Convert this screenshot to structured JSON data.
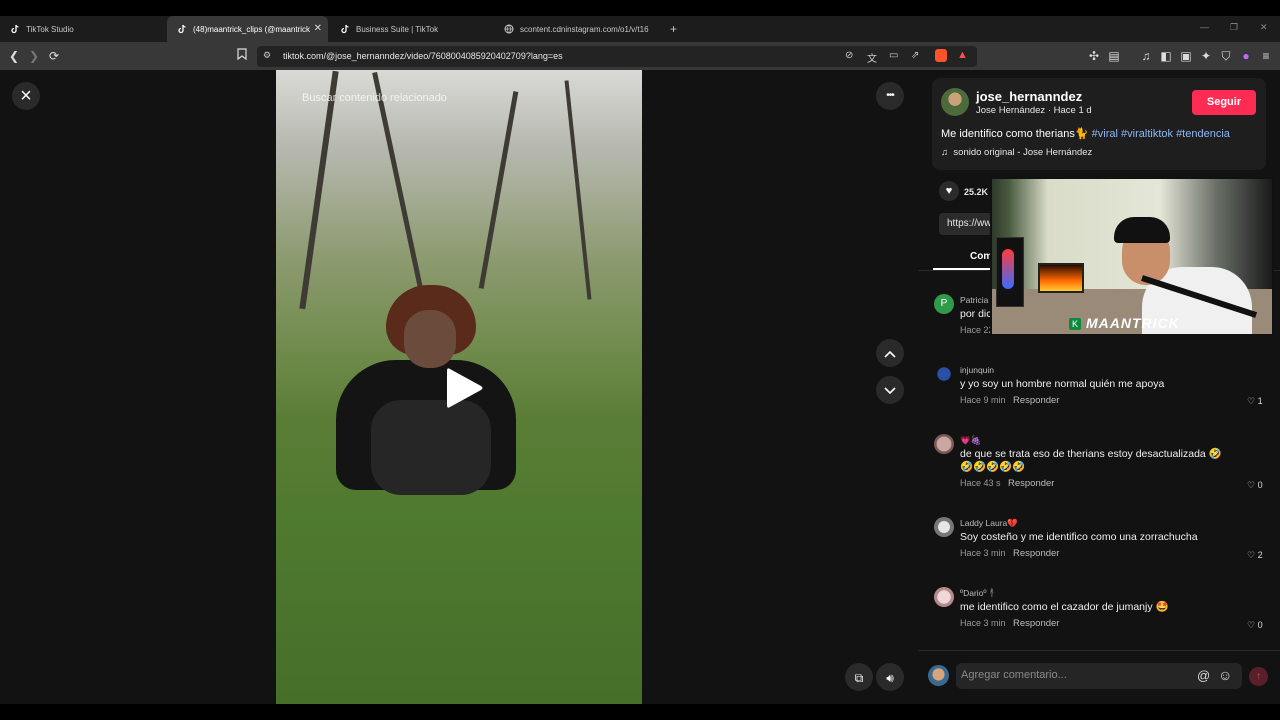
{
  "browser": {
    "tabs": [
      {
        "label": "TikTok Studio",
        "active": false
      },
      {
        "label": "(48)maantrick_clips (@maantrick",
        "active": true
      },
      {
        "label": "Business Suite | TikTok",
        "active": false
      },
      {
        "label": "scontent.cdninstagram.com/o1/v/t16",
        "active": false
      }
    ],
    "new_tab": "+",
    "url": "tiktok.com/@jose_hernanndez/video/7608004085920402709?lang=es"
  },
  "video": {
    "overlay_text": "Buscar contenido relacionado",
    "close_icon": "×",
    "more_icon": "•••"
  },
  "post": {
    "username": "jose_hernanndez",
    "subline": "Jose Hernández · Hace 1 d",
    "follow_label": "Seguir",
    "caption": "Me identifico como therians",
    "hashtags": [
      "#viral",
      "#viraltiktok",
      "#tendencia"
    ],
    "sound": "sonido original - Jose Hernández",
    "likes": "25.2K",
    "link_text": "https://ww",
    "comments_tab": "Com"
  },
  "webcam": {
    "label": "MAANTRICK"
  },
  "comments": [
    {
      "name": "Patricia",
      "text": "por dic",
      "time": "Hace 22",
      "reply": "",
      "likes": ""
    },
    {
      "name": "injunquin",
      "text": "y yo soy un hombre normal quién me apoya",
      "time": "Hace 9 min",
      "reply": "Responder",
      "likes": "1"
    },
    {
      "name": "💗🍇",
      "text": "de que se trata eso de therians estoy desactualizada 🤣🤣🤣🤣🤣🤣",
      "time": "Hace 43 s",
      "reply": "Responder",
      "likes": "0"
    },
    {
      "name": "Laddy Laura💔",
      "text": "Soy costeño y me identifico como una zorrachucha",
      "time": "Hace 3 min",
      "reply": "Responder",
      "likes": "2"
    },
    {
      "name": "ºDarioº🕴️",
      "text": "me identifico como el cazador de jumanjy 🤩",
      "time": "Hace 3 min",
      "reply": "Responder",
      "likes": "0"
    }
  ],
  "comment_input": {
    "placeholder": "Agregar comentario..."
  },
  "colors": {
    "accent": "#fe2c55",
    "hashtag": "#8fb7f6"
  }
}
